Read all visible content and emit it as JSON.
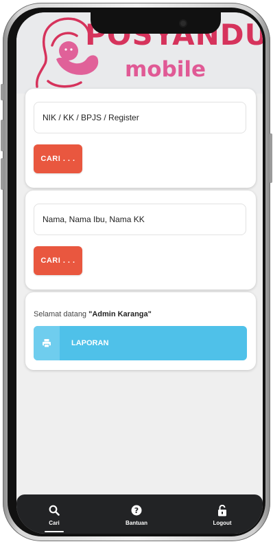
{
  "header": {
    "brand": "POSYANDU",
    "brand_sub": "mobile"
  },
  "search_nik": {
    "placeholder": "NIK / KK / BPJS / Register",
    "button_label": "CARI . . ."
  },
  "search_nama": {
    "placeholder": "Nama, Nama Ibu, Nama KK",
    "button_label": "CARI . . ."
  },
  "welcome": {
    "prefix": "Selamat datang ",
    "user": "\"Admin Karanga\""
  },
  "laporan": {
    "label": "LAPORAN",
    "icon": "printer-icon"
  },
  "bottom_nav": {
    "items": [
      {
        "label": "Cari",
        "icon": "search-icon",
        "active": true
      },
      {
        "label": "Bantuan",
        "icon": "help-circle-icon",
        "active": false
      },
      {
        "label": "Logout",
        "icon": "unlock-icon",
        "active": false
      }
    ]
  },
  "colors": {
    "brand": "#d6335c",
    "brand_sub": "#e05a95",
    "search_button": "#e9573f",
    "laporan_button": "#4fc1e9",
    "nav_background": "#222325"
  }
}
